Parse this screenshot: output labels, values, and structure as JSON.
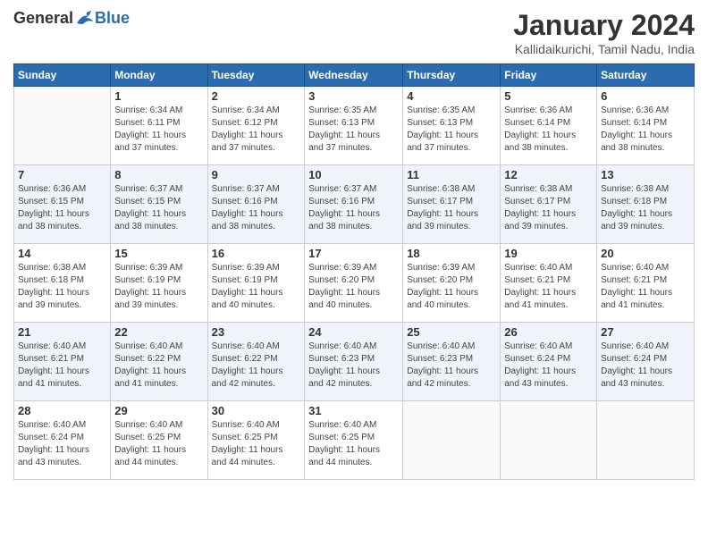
{
  "header": {
    "logo_general": "General",
    "logo_blue": "Blue",
    "main_title": "January 2024",
    "subtitle": "Kallidaikurichi, Tamil Nadu, India"
  },
  "calendar": {
    "days_of_week": [
      "Sunday",
      "Monday",
      "Tuesday",
      "Wednesday",
      "Thursday",
      "Friday",
      "Saturday"
    ],
    "weeks": [
      [
        {
          "day": "",
          "info": ""
        },
        {
          "day": "1",
          "info": "Sunrise: 6:34 AM\nSunset: 6:11 PM\nDaylight: 11 hours\nand 37 minutes."
        },
        {
          "day": "2",
          "info": "Sunrise: 6:34 AM\nSunset: 6:12 PM\nDaylight: 11 hours\nand 37 minutes."
        },
        {
          "day": "3",
          "info": "Sunrise: 6:35 AM\nSunset: 6:13 PM\nDaylight: 11 hours\nand 37 minutes."
        },
        {
          "day": "4",
          "info": "Sunrise: 6:35 AM\nSunset: 6:13 PM\nDaylight: 11 hours\nand 37 minutes."
        },
        {
          "day": "5",
          "info": "Sunrise: 6:36 AM\nSunset: 6:14 PM\nDaylight: 11 hours\nand 38 minutes."
        },
        {
          "day": "6",
          "info": "Sunrise: 6:36 AM\nSunset: 6:14 PM\nDaylight: 11 hours\nand 38 minutes."
        }
      ],
      [
        {
          "day": "7",
          "info": "Sunrise: 6:36 AM\nSunset: 6:15 PM\nDaylight: 11 hours\nand 38 minutes."
        },
        {
          "day": "8",
          "info": "Sunrise: 6:37 AM\nSunset: 6:15 PM\nDaylight: 11 hours\nand 38 minutes."
        },
        {
          "day": "9",
          "info": "Sunrise: 6:37 AM\nSunset: 6:16 PM\nDaylight: 11 hours\nand 38 minutes."
        },
        {
          "day": "10",
          "info": "Sunrise: 6:37 AM\nSunset: 6:16 PM\nDaylight: 11 hours\nand 38 minutes."
        },
        {
          "day": "11",
          "info": "Sunrise: 6:38 AM\nSunset: 6:17 PM\nDaylight: 11 hours\nand 39 minutes."
        },
        {
          "day": "12",
          "info": "Sunrise: 6:38 AM\nSunset: 6:17 PM\nDaylight: 11 hours\nand 39 minutes."
        },
        {
          "day": "13",
          "info": "Sunrise: 6:38 AM\nSunset: 6:18 PM\nDaylight: 11 hours\nand 39 minutes."
        }
      ],
      [
        {
          "day": "14",
          "info": "Sunrise: 6:38 AM\nSunset: 6:18 PM\nDaylight: 11 hours\nand 39 minutes."
        },
        {
          "day": "15",
          "info": "Sunrise: 6:39 AM\nSunset: 6:19 PM\nDaylight: 11 hours\nand 39 minutes."
        },
        {
          "day": "16",
          "info": "Sunrise: 6:39 AM\nSunset: 6:19 PM\nDaylight: 11 hours\nand 40 minutes."
        },
        {
          "day": "17",
          "info": "Sunrise: 6:39 AM\nSunset: 6:20 PM\nDaylight: 11 hours\nand 40 minutes."
        },
        {
          "day": "18",
          "info": "Sunrise: 6:39 AM\nSunset: 6:20 PM\nDaylight: 11 hours\nand 40 minutes."
        },
        {
          "day": "19",
          "info": "Sunrise: 6:40 AM\nSunset: 6:21 PM\nDaylight: 11 hours\nand 41 minutes."
        },
        {
          "day": "20",
          "info": "Sunrise: 6:40 AM\nSunset: 6:21 PM\nDaylight: 11 hours\nand 41 minutes."
        }
      ],
      [
        {
          "day": "21",
          "info": "Sunrise: 6:40 AM\nSunset: 6:21 PM\nDaylight: 11 hours\nand 41 minutes."
        },
        {
          "day": "22",
          "info": "Sunrise: 6:40 AM\nSunset: 6:22 PM\nDaylight: 11 hours\nand 41 minutes."
        },
        {
          "day": "23",
          "info": "Sunrise: 6:40 AM\nSunset: 6:22 PM\nDaylight: 11 hours\nand 42 minutes."
        },
        {
          "day": "24",
          "info": "Sunrise: 6:40 AM\nSunset: 6:23 PM\nDaylight: 11 hours\nand 42 minutes."
        },
        {
          "day": "25",
          "info": "Sunrise: 6:40 AM\nSunset: 6:23 PM\nDaylight: 11 hours\nand 42 minutes."
        },
        {
          "day": "26",
          "info": "Sunrise: 6:40 AM\nSunset: 6:24 PM\nDaylight: 11 hours\nand 43 minutes."
        },
        {
          "day": "27",
          "info": "Sunrise: 6:40 AM\nSunset: 6:24 PM\nDaylight: 11 hours\nand 43 minutes."
        }
      ],
      [
        {
          "day": "28",
          "info": "Sunrise: 6:40 AM\nSunset: 6:24 PM\nDaylight: 11 hours\nand 43 minutes."
        },
        {
          "day": "29",
          "info": "Sunrise: 6:40 AM\nSunset: 6:25 PM\nDaylight: 11 hours\nand 44 minutes."
        },
        {
          "day": "30",
          "info": "Sunrise: 6:40 AM\nSunset: 6:25 PM\nDaylight: 11 hours\nand 44 minutes."
        },
        {
          "day": "31",
          "info": "Sunrise: 6:40 AM\nSunset: 6:25 PM\nDaylight: 11 hours\nand 44 minutes."
        },
        {
          "day": "",
          "info": ""
        },
        {
          "day": "",
          "info": ""
        },
        {
          "day": "",
          "info": ""
        }
      ]
    ]
  }
}
